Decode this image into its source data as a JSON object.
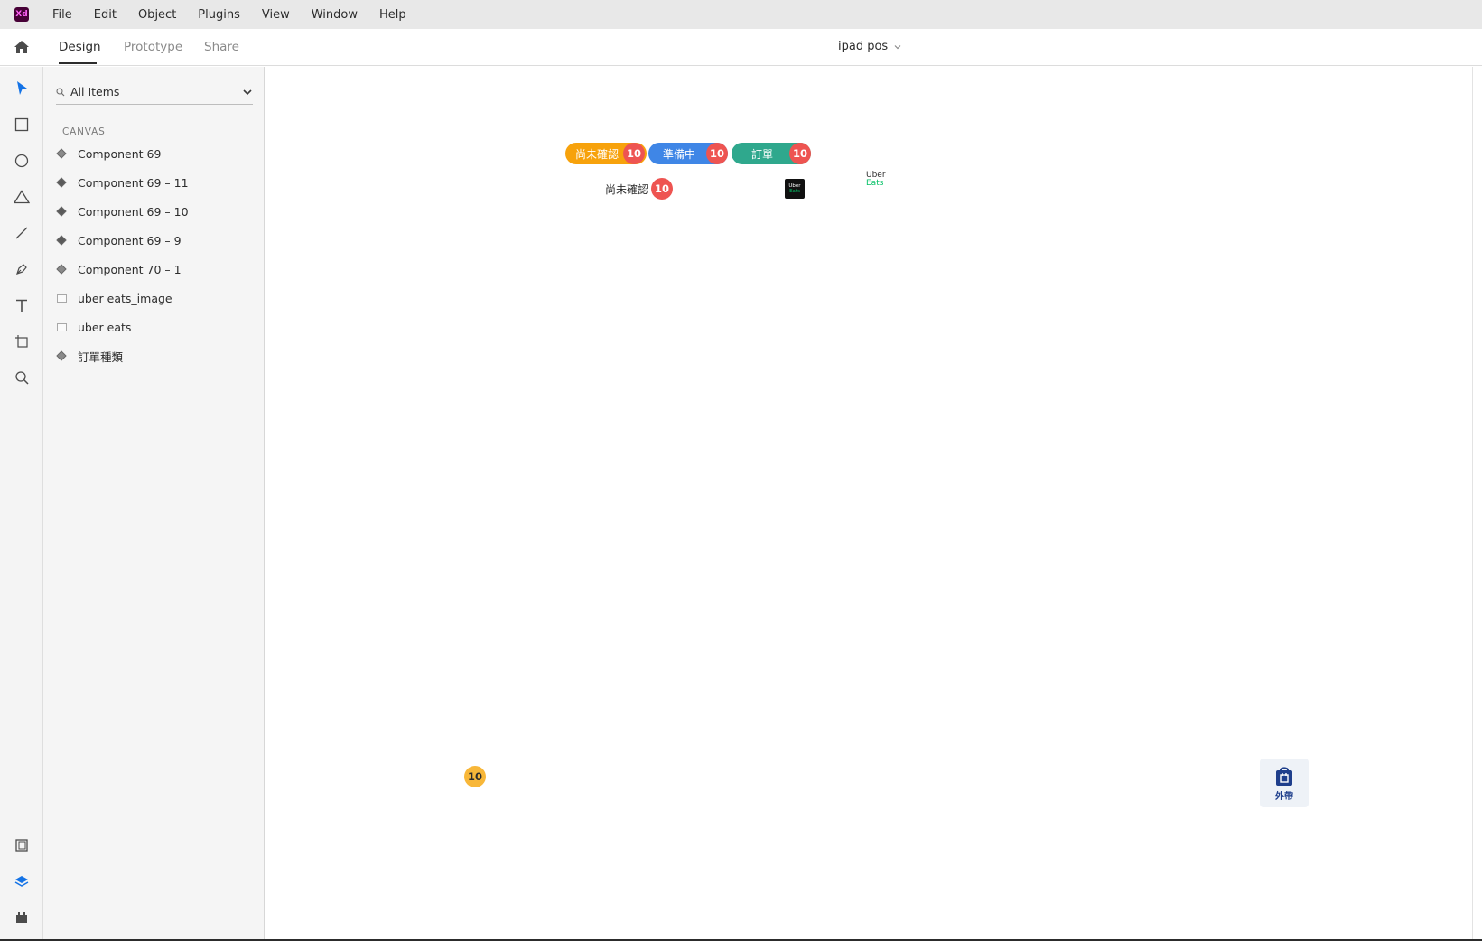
{
  "app": {
    "logo": "Xd"
  },
  "menu": [
    "File",
    "Edit",
    "Object",
    "Plugins",
    "View",
    "Window",
    "Help"
  ],
  "modes": {
    "design": "Design",
    "prototype": "Prototype",
    "share": "Share"
  },
  "document": {
    "title": "ipad pos"
  },
  "toolbar": {
    "tools": [
      "select-icon",
      "rectangle-icon",
      "ellipse-icon",
      "polygon-icon",
      "line-icon",
      "pen-icon",
      "text-icon",
      "artboard-icon",
      "zoom-icon"
    ],
    "bottom": [
      "assets-icon",
      "layers-icon",
      "plugins-icon"
    ]
  },
  "layers": {
    "filter": "All Items",
    "section": "CANVAS",
    "items": [
      {
        "label": "Component 69",
        "icon": "component-icon"
      },
      {
        "label": "Component 69 – 11",
        "icon": "component-icon"
      },
      {
        "label": "Component 69 – 10",
        "icon": "component-icon"
      },
      {
        "label": "Component 69 – 9",
        "icon": "component-icon"
      },
      {
        "label": "Component 70 – 1",
        "icon": "component-icon"
      },
      {
        "label": "uber eats_image",
        "icon": "image-icon"
      },
      {
        "label": "uber eats",
        "icon": "image-icon"
      },
      {
        "label": "訂單種類",
        "icon": "component-icon"
      }
    ]
  },
  "canvas": {
    "pills": [
      {
        "label": "尚未確認",
        "count": "10",
        "color": "#f7a20c"
      },
      {
        "label": "準備中",
        "count": "10",
        "color": "#3f86e6"
      },
      {
        "label": "訂單",
        "count": "10",
        "color": "#2fa88d"
      }
    ],
    "unconfirmed": {
      "label": "尚未確認",
      "count": "10"
    },
    "uber_square": {
      "line1": "Uber",
      "line2": "Eats"
    },
    "uber_logo": {
      "line1": "Uber",
      "line2": "Eats"
    },
    "yellow_badge": "10",
    "takeout": {
      "label": "外帶"
    }
  },
  "colors": {
    "accent": "#1473e6",
    "badge": "#ee5451",
    "brand_green": "#06c167",
    "layers_active": "#1473e6"
  }
}
